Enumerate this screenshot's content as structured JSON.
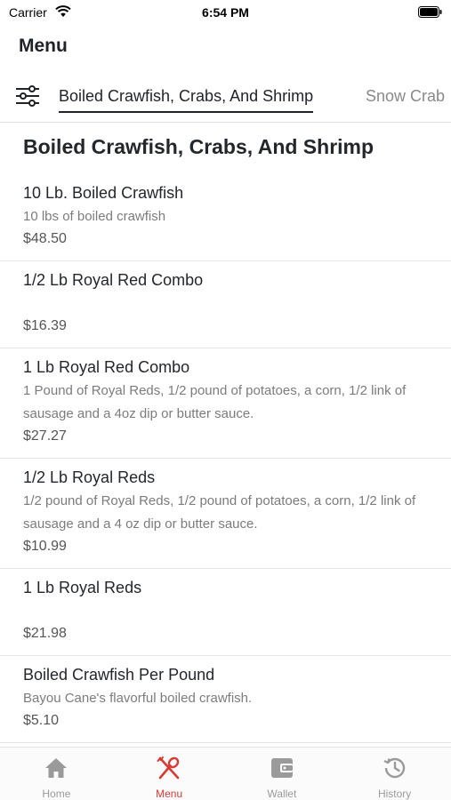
{
  "status_bar": {
    "carrier": "Carrier",
    "time": "6:54 PM"
  },
  "header": {
    "title": "Menu"
  },
  "categories": [
    {
      "label": "Boiled Crawfish, Crabs, And Shrimp",
      "active": true
    },
    {
      "label": "Snow Crab",
      "active": false
    }
  ],
  "section": {
    "title": "Boiled Crawfish, Crabs, And Shrimp"
  },
  "items": [
    {
      "name": "10 Lb. Boiled Crawfish",
      "description": "10 lbs of boiled crawfish",
      "price": "$48.50"
    },
    {
      "name": "1/2 Lb Royal Red Combo",
      "description": "",
      "price": "$16.39"
    },
    {
      "name": "1 Lb Royal Red Combo",
      "description": "1 Pound of Royal Reds, 1/2 pound of potatoes, a corn, 1/2 link of sausage and a 4oz dip or butter sauce.",
      "price": "$27.27"
    },
    {
      "name": "1/2 Lb Royal Reds",
      "description": "1/2 pound of Royal Reds, 1/2 pound of potatoes, a corn, 1/2 link of sausage and a 4 oz dip or butter sauce.",
      "price": "$10.99"
    },
    {
      "name": "1 Lb Royal Reds",
      "description": "",
      "price": "$21.98"
    },
    {
      "name": "Boiled Crawfish Per Pound",
      "description": "Bayou Cane's flavorful boiled crawfish.",
      "price": "$5.10"
    }
  ],
  "tab_bar": {
    "home": "Home",
    "menu": "Menu",
    "wallet": "Wallet",
    "history": "History",
    "active_color": "#d83a34",
    "inactive_color": "#9a9a9a"
  }
}
